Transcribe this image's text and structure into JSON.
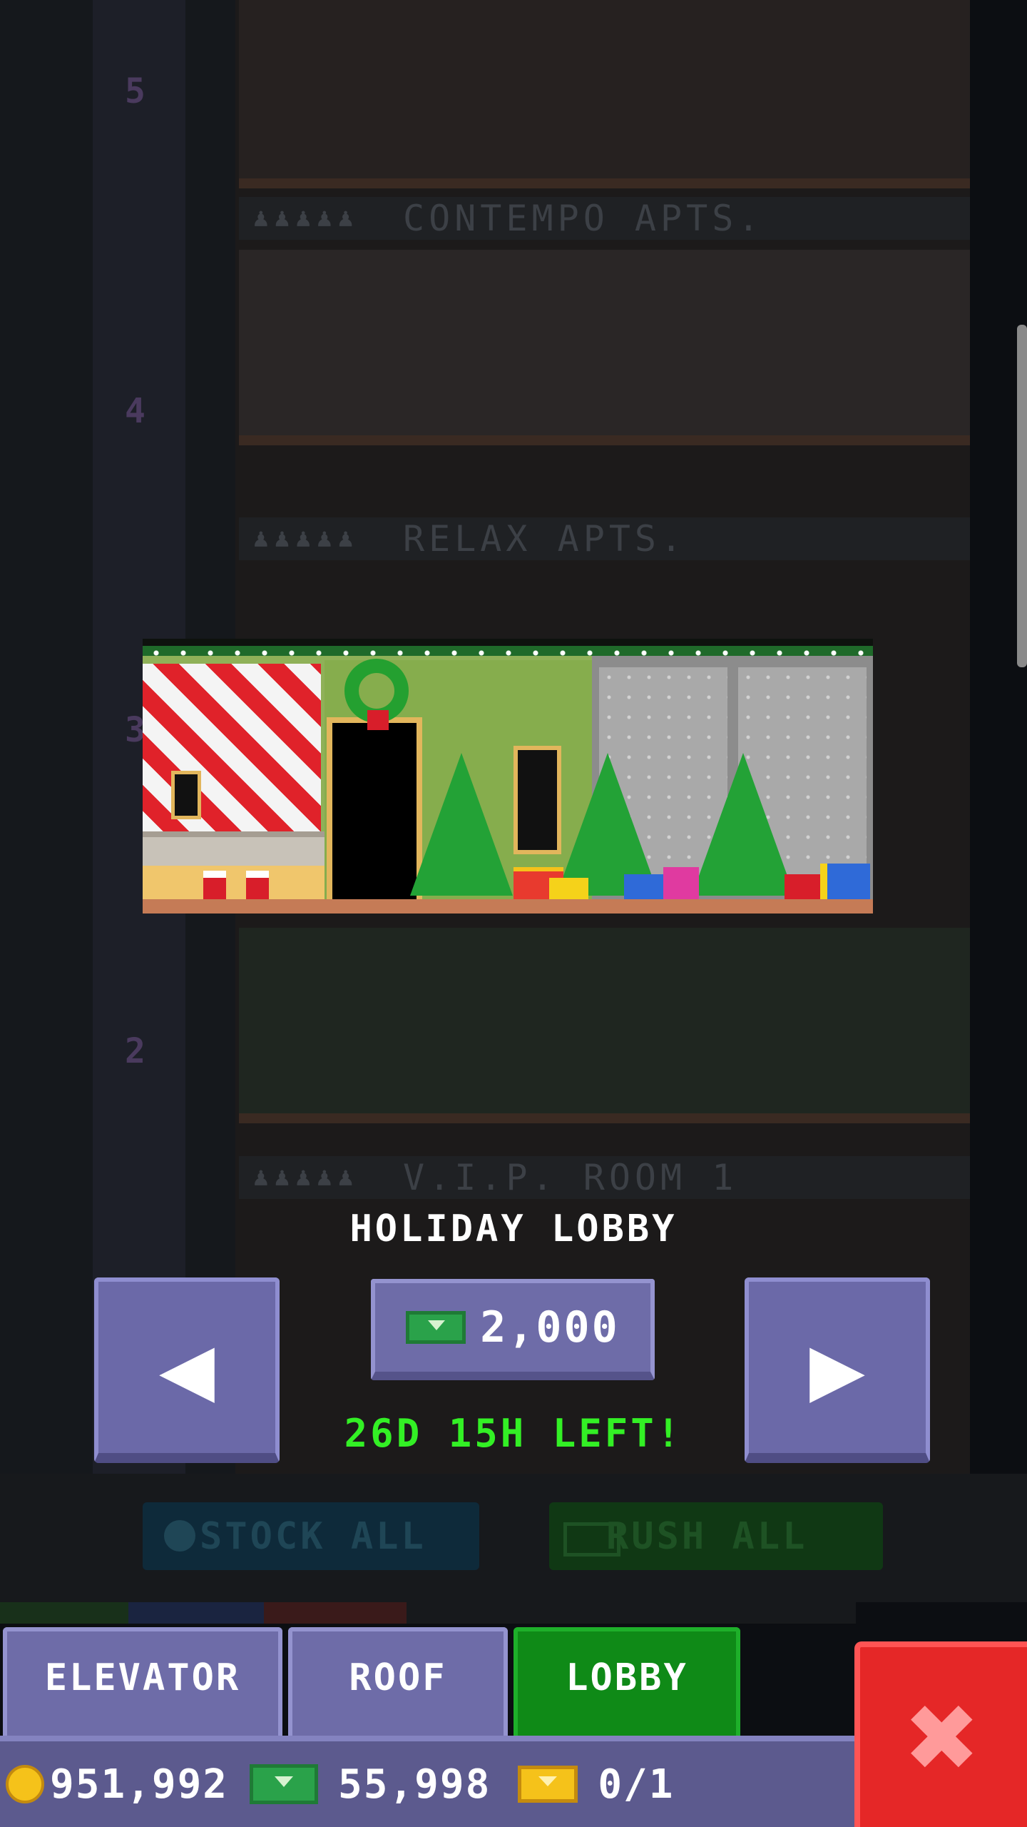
{
  "background": {
    "floors": [
      "5",
      "4",
      "3",
      "2"
    ],
    "signs": [
      "CONTEMPO APTS.",
      "RELAX APTS.",
      "V.I.P. ROOM 1"
    ]
  },
  "picker": {
    "title": "HOLIDAY LOBBY",
    "price": "2,000",
    "price_icon": "bux-icon",
    "timer": "26D 15H LEFT!",
    "prev_label": "◀",
    "next_label": "▶"
  },
  "actions": {
    "stock_all": "STOCK ALL",
    "rush_all": "RUSH ALL"
  },
  "tabs": [
    {
      "label": "ELEVATOR",
      "active": false
    },
    {
      "label": "ROOF",
      "active": false
    },
    {
      "label": "LOBBY",
      "active": true
    }
  ],
  "currency": {
    "coins": "951,992",
    "bux": "55,998",
    "tickets": "0/1"
  },
  "close_label": "✖",
  "colors": {
    "accent_green": "#33f025",
    "button_purple": "#6e6ca8",
    "tab_active_green": "#0f8a17",
    "close_red": "#e52727"
  }
}
